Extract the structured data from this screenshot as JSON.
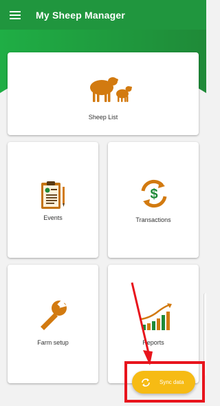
{
  "app": {
    "title": "My Sheep Manager",
    "menu_icon": "hamburger-menu-icon"
  },
  "colors": {
    "primary": "#20963e",
    "accent": "#f6bb14",
    "icon_orange": "#d27a10",
    "annotation_red": "#e8141c"
  },
  "tiles": {
    "sheep_list": {
      "label": "Sheep List",
      "icon": "sheep-icon"
    },
    "events": {
      "label": "Events",
      "icon": "clipboard-icon"
    },
    "transactions": {
      "label": "Transactions",
      "icon": "dollar-cycle-icon"
    },
    "farm_setup": {
      "label": "Farm setup",
      "icon": "wrench-icon"
    },
    "reports": {
      "label": "Reports",
      "icon": "bar-chart-icon"
    }
  },
  "fab": {
    "label": "Sync data",
    "icon": "sync-icon"
  }
}
